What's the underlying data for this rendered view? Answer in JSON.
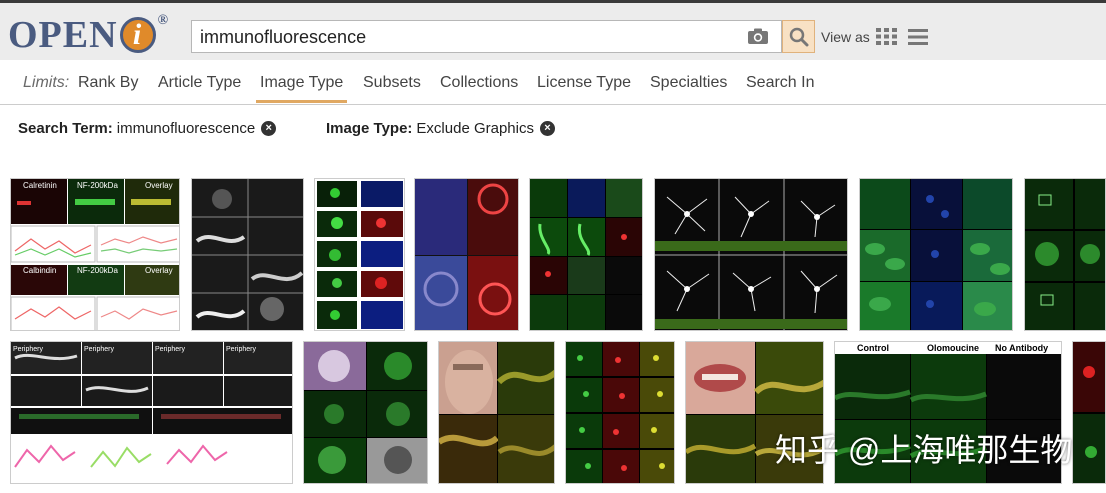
{
  "logo": {
    "text_open": "OPEN",
    "text_i": "i",
    "reg": "®"
  },
  "search": {
    "value": "immunofluorescence"
  },
  "header": {
    "view_as": "View as"
  },
  "limits": {
    "label": "Limits:",
    "tabs": [
      "Rank By",
      "Article Type",
      "Image Type",
      "Subsets",
      "Collections",
      "License Type",
      "Specialties",
      "Search In"
    ],
    "active_tab": "Image Type"
  },
  "filters": [
    {
      "label": "Search Term:",
      "value": "immunofluorescence"
    },
    {
      "label": "Image Type:",
      "value": "Exclude Graphics"
    }
  ],
  "thumbnails_row1": [
    {
      "name": "thumb-calretinin-panels",
      "labels": [
        "Calretinin",
        "NF-200kDa",
        "Overlay",
        "Calbindin",
        "NF-200kDa",
        "Overlay"
      ]
    },
    {
      "name": "thumb-grayscale-tissue"
    },
    {
      "name": "thumb-green-blue-cells"
    },
    {
      "name": "thumb-blue-red-tissue"
    },
    {
      "name": "thumb-green-red-grid"
    },
    {
      "name": "thumb-neuron-white"
    },
    {
      "name": "thumb-green-cells-grid"
    },
    {
      "name": "thumb-green-partial"
    }
  ],
  "thumbnails_row2": [
    {
      "name": "thumb-periphery-plots",
      "labels": [
        "Periphery",
        "Periphery",
        "Periphery",
        "Periphery"
      ]
    },
    {
      "name": "thumb-histology-purple"
    },
    {
      "name": "thumb-face-lesion"
    },
    {
      "name": "thumb-red-green-yellow"
    },
    {
      "name": "thumb-lips-lesion"
    },
    {
      "name": "thumb-olomoucine",
      "labels": [
        "Control",
        "Olomoucine",
        "No Antibody"
      ]
    },
    {
      "name": "thumb-red-partial"
    }
  ],
  "watermark": "知乎 @上海唯那生物",
  "colors": {
    "accent": "#e0a862",
    "logo": "#4a5b80",
    "logo_orange": "#e08a2a"
  }
}
